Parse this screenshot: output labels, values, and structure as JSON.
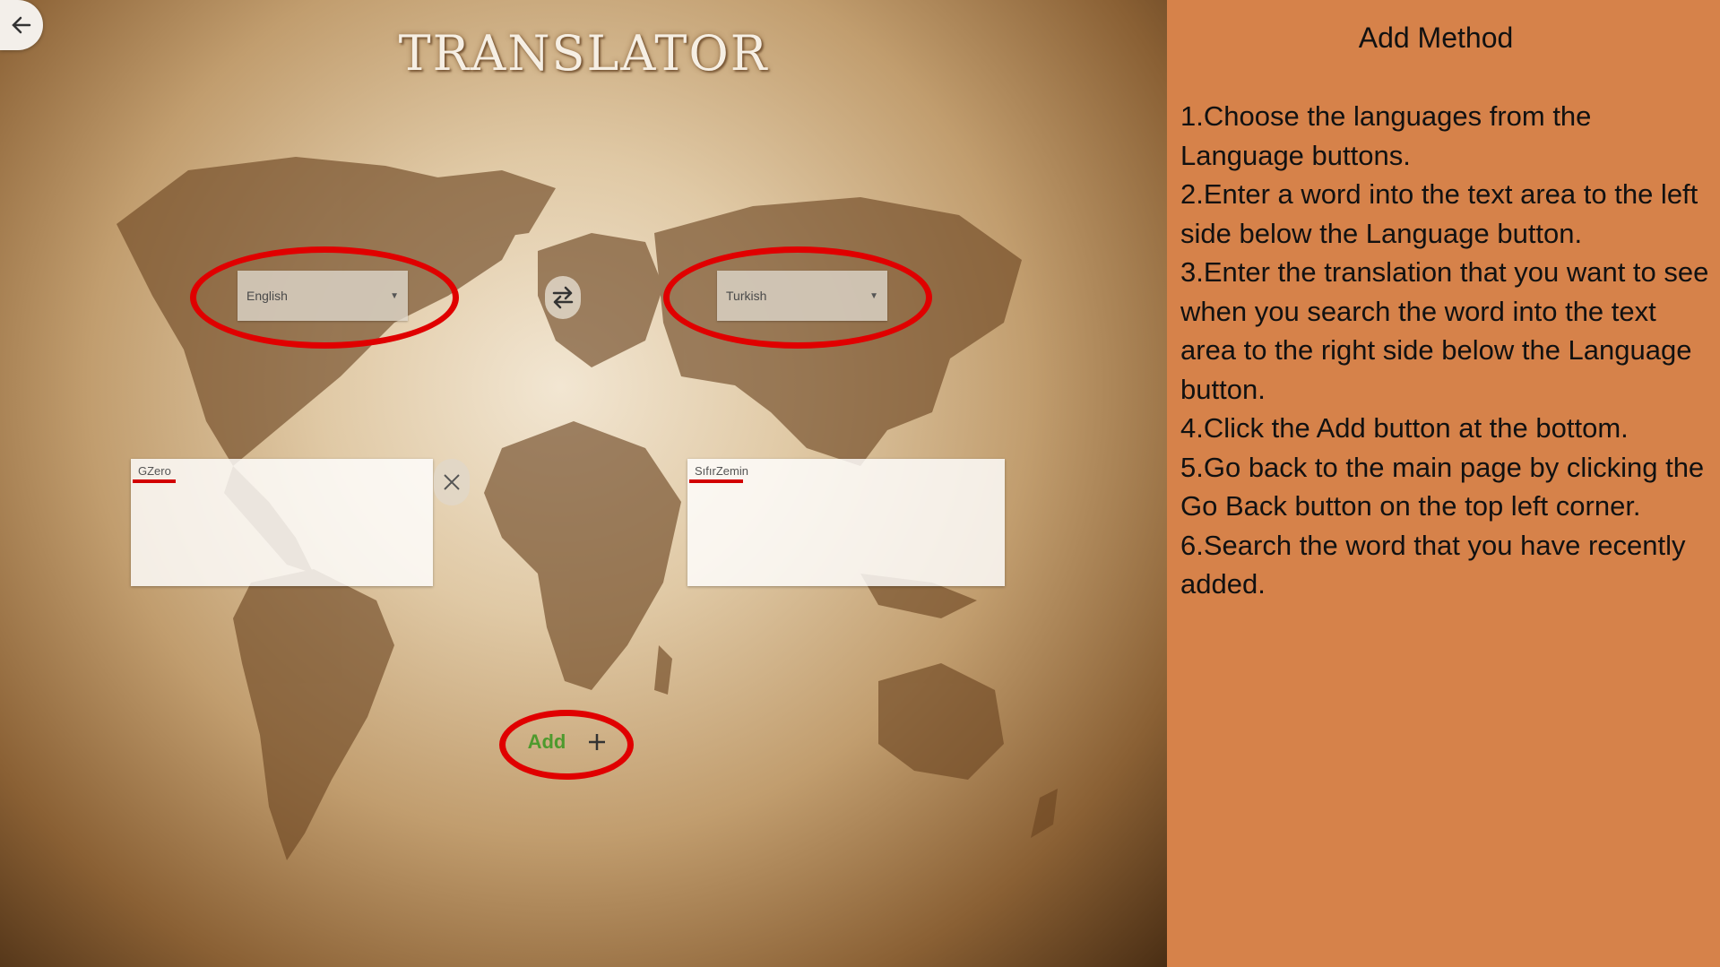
{
  "app": {
    "title": "TRANSLATOR",
    "back_icon": "arrow-left-icon",
    "source_language": "English",
    "target_language": "Turkish",
    "swap_icon": "swap-arrows-icon",
    "source_text": "GZero",
    "target_text": "SıfırZemin",
    "clear_icon": "close-icon",
    "add_label": "Add",
    "add_icon": "plus-icon",
    "highlight_color": "#e00000",
    "add_color": "#4e9a2e"
  },
  "help": {
    "heading": "Add Method",
    "steps": [
      "1.Choose the languages from the Language buttons.",
      "2.Enter a word into the text area to the left side below the Language button.",
      "3.Enter the translation that you want to see when you search the word into the text area to the right side below the Language button.",
      "4.Click the Add button at the bottom.",
      "5.Go back to the main page by clicking the Go Back button on the top left corner.",
      "6.Search the word that you have recently added."
    ],
    "background": "#d6824a"
  }
}
